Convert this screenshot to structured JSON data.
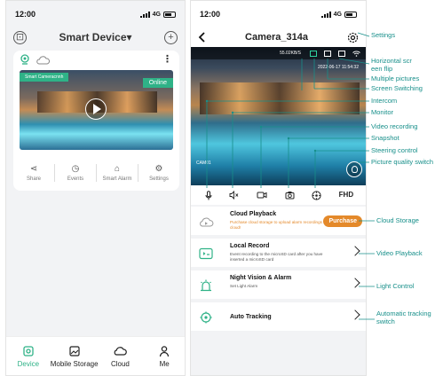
{
  "phone1": {
    "status_time": "12:00",
    "status_network": "4G",
    "title": "Smart Device▾",
    "device_name": "Smart Cameracnnh",
    "status": "Online",
    "actions": [
      {
        "label": "Share",
        "icon": "share-icon",
        "glyph": "⋖"
      },
      {
        "label": "Events",
        "icon": "events-icon",
        "glyph": "◷"
      },
      {
        "label": "Smart Alarm",
        "icon": "smart-alarm-icon",
        "glyph": "⌂"
      },
      {
        "label": "Settings",
        "icon": "settings-icon",
        "glyph": "⚙"
      }
    ],
    "tabs": [
      {
        "label": "Device",
        "icon": "device-icon",
        "glyph": "◉",
        "active": true
      },
      {
        "label": "Mobile Storage",
        "icon": "mobile-storage-icon",
        "glyph": "▣",
        "active": false
      },
      {
        "label": "Cloud",
        "icon": "cloud-icon",
        "glyph": "☁",
        "active": false
      },
      {
        "label": "Me",
        "icon": "me-icon",
        "glyph": "♙",
        "active": false
      }
    ]
  },
  "phone2": {
    "status_time": "12:00",
    "status_network": "4G",
    "title": "Camera_314a",
    "speed": "55.02KB/S",
    "timestamp": "2022-06-17 11:54:32",
    "camera_label": "CAM01",
    "quality": "FHD",
    "rows": [
      {
        "title": "Cloud Playback",
        "subtitle": "Purchase cloud storage to upload alarm recordings to cloud!",
        "button": "Purchase"
      },
      {
        "title": "Local Record",
        "subtitle": "Event recording to the microSD card after you have inserted a microSD card"
      },
      {
        "title": "Night Vision & Alarm",
        "subtitle": "Set Light Alarm"
      },
      {
        "title": "Auto Tracking",
        "subtitle": ""
      }
    ]
  },
  "annotations": {
    "settings": "Settings",
    "flip": "Horizontal scr\neen flip",
    "multi": "Multiple pictures",
    "switching": "Screen Switching",
    "intercom": "Intercom",
    "monitor": "Monitor",
    "video": "Video recording",
    "snapshot": "Snapshot",
    "steering": "Steering control",
    "quality": "Picture quality switch",
    "cloud": "Cloud Storage",
    "playback": "Video Playback",
    "light": "Light Control",
    "tracking": "Automatic tracking\nswitch"
  },
  "colors": {
    "accent": "#2fb287",
    "annotation": "#178f8a",
    "purchase": "#e4892a"
  }
}
